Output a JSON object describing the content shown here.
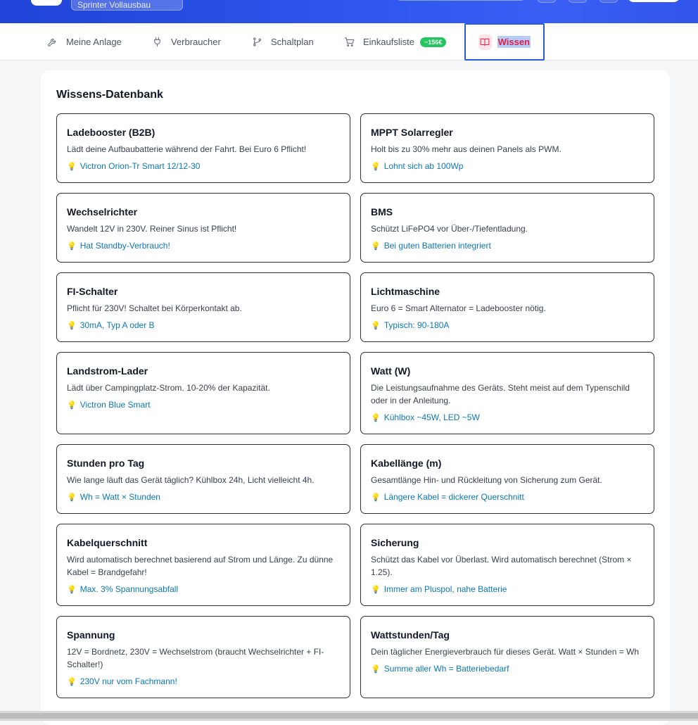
{
  "header": {
    "project_name": "Sprinter Vollausbau"
  },
  "tabs": [
    {
      "label": "Meine Anlage",
      "icon": "wrench-icon"
    },
    {
      "label": "Verbraucher",
      "icon": "plug-icon"
    },
    {
      "label": "Schaltplan",
      "icon": "branch-icon"
    },
    {
      "label": "Einkaufsliste",
      "icon": "cart-icon",
      "badge": "~156€"
    },
    {
      "label": "Wissen",
      "icon": "book-open-icon",
      "active": true
    }
  ],
  "knowledge": {
    "title": "Wissens-Datenbank",
    "tip_icon": "💡",
    "cards": [
      {
        "title": "Ladebooster (B2B)",
        "desc": "Lädt deine Aufbaubatterie während der Fahrt. Bei Euro 6 Pflicht!",
        "tip": "Victron Orion-Tr Smart 12/12-30"
      },
      {
        "title": "MPPT Solarregler",
        "desc": "Holt bis zu 30% mehr aus deinen Panels als PWM.",
        "tip": "Lohnt sich ab 100Wp"
      },
      {
        "title": "Wechselrichter",
        "desc": "Wandelt 12V in 230V. Reiner Sinus ist Pflicht!",
        "tip": "Hat Standby-Verbrauch!"
      },
      {
        "title": "BMS",
        "desc": "Schützt LiFePO4 vor Über-/Tiefentladung.",
        "tip": "Bei guten Batterien integriert"
      },
      {
        "title": "FI-Schalter",
        "desc": "Pflicht für 230V! Schaltet bei Körperkontakt ab.",
        "tip": "30mA, Typ A oder B"
      },
      {
        "title": "Lichtmaschine",
        "desc": "Euro 6 = Smart Alternator = Ladebooster nötig.",
        "tip": "Typisch: 90-180A"
      },
      {
        "title": "Landstrom-Lader",
        "desc": "Lädt über Campingplatz-Strom. 10-20% der Kapazität.",
        "tip": "Victron Blue Smart"
      },
      {
        "title": "Watt (W)",
        "desc": "Die Leistungsaufnahme des Geräts. Steht meist auf dem Typenschild oder in der Anleitung.",
        "tip": "Kühlbox ~45W, LED ~5W"
      },
      {
        "title": "Stunden pro Tag",
        "desc": "Wie lange läuft das Gerät täglich? Kühlbox 24h, Licht vielleicht 4h.",
        "tip": "Wh = Watt × Stunden"
      },
      {
        "title": "Kabellänge (m)",
        "desc": "Gesamtlänge Hin- und Rückleitung von Sicherung zum Gerät.",
        "tip": "Längere Kabel = dickerer Querschnitt"
      },
      {
        "title": "Kabelquerschnitt",
        "desc": "Wird automatisch berechnet basierend auf Strom und Länge. Zu dünne Kabel = Brandgefahr!",
        "tip": "Max. 3% Spannungsabfall"
      },
      {
        "title": "Sicherung",
        "desc": "Schützt das Kabel vor Überlast. Wird automatisch berechnet (Strom × 1.25).",
        "tip": "Immer am Pluspol, nahe Batterie"
      },
      {
        "title": "Spannung",
        "desc": "12V = Bordnetz, 230V = Wechselstrom (braucht Wechselrichter + FI-Schalter!)",
        "tip": "230V nur vom Fachmann!"
      },
      {
        "title": "Wattstunden/Tag",
        "desc": "Dein täglicher Energieverbrauch für dieses Gerät. Watt × Stunden = Wh",
        "tip": "Summe aller Wh = Batteriebedarf"
      }
    ]
  }
}
